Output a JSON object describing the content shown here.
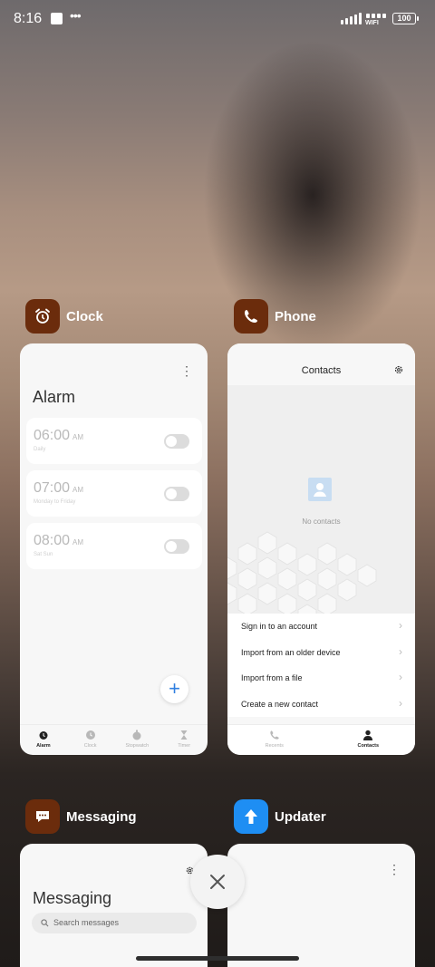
{
  "status_bar": {
    "time": "8:16",
    "wifi_label": "WIFI",
    "battery": "100"
  },
  "apps": {
    "clock": {
      "name": "Clock",
      "icon": "alarm-clock-icon",
      "icon_color": "#6b2c0c",
      "screen_title": "Alarm",
      "alarms": [
        {
          "time": "06:00",
          "ampm": "AM",
          "repeat": "Daily"
        },
        {
          "time": "07:00",
          "ampm": "AM",
          "repeat": "Monday to Friday"
        },
        {
          "time": "08:00",
          "ampm": "AM",
          "repeat": "Sat Sun"
        }
      ],
      "tabs": [
        "Alarm",
        "Clock",
        "Stopwatch",
        "Timer"
      ],
      "active_tab": "Alarm"
    },
    "phone": {
      "name": "Phone",
      "icon": "phone-icon",
      "icon_color": "#6b2c0c",
      "screen_title": "Contacts",
      "empty_text": "No contacts",
      "menu": [
        "Sign in to an account",
        "Import from an older device",
        "Import from a file",
        "Create a new contact"
      ],
      "tabs": [
        "Recents",
        "Contacts"
      ],
      "active_tab": "Contacts"
    },
    "messaging": {
      "name": "Messaging",
      "icon": "message-icon",
      "icon_color": "#6b2c0c",
      "screen_title": "Messaging",
      "search_placeholder": "Search messages"
    },
    "updater": {
      "name": "Updater",
      "icon": "update-arrow-icon",
      "icon_color": "#1e8ef3"
    }
  },
  "accent_color": "#2f7fe0"
}
